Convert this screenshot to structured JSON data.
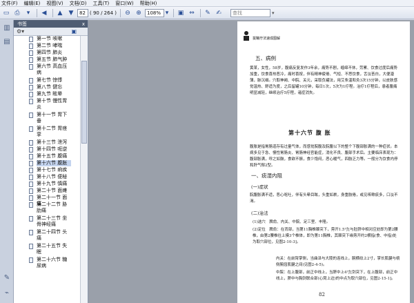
{
  "menu": [
    "文件(F)",
    "编辑(E)",
    "视图(V)",
    "文档(D)",
    "工具(T)",
    "窗口(W)",
    "帮助(H)"
  ],
  "toolbar": {
    "page_current": "82",
    "page_total": "( 90 / 264 )",
    "zoom": "108%",
    "search_placeholder": "查找"
  },
  "panel": {
    "title": "书签",
    "close": "x"
  },
  "bookmarks": [
    {
      "label": "第一节 咳嗽",
      "lines": 1
    },
    {
      "label": "第二节 哮喘",
      "lines": 1
    },
    {
      "label": "第四节 肺炎",
      "lines": 1
    },
    {
      "label": "第五节 肺气肿",
      "lines": 1
    },
    {
      "label": "第六节 高血压病",
      "lines": 2
    },
    {
      "label": "第七节 惊悸",
      "lines": 1
    },
    {
      "label": "第八节 健忘",
      "lines": 1
    },
    {
      "label": "第九节 眩晕",
      "lines": 1
    },
    {
      "label": "第十节 慢性胃炎",
      "lines": 2
    },
    {
      "label": "第十一节 胃下垂",
      "lines": 2
    },
    {
      "label": "第十二节 胃痉挛",
      "lines": 2
    },
    {
      "label": "第十三节 泄泻",
      "lines": 1
    },
    {
      "label": "第十四节 呃逆",
      "lines": 1
    },
    {
      "label": "第十五节 腹痛",
      "lines": 1
    },
    {
      "label": "第十六节 腹胀",
      "lines": 1,
      "selected": true
    },
    {
      "label": "第十七节 痢疾",
      "lines": 1
    },
    {
      "label": "第十八节 便秘",
      "lines": 1
    },
    {
      "label": "第十九节 慎痛",
      "lines": 1
    },
    {
      "label": "第二十节 面瘫",
      "lines": 1
    },
    {
      "label": "第二十一节 面痛",
      "lines": 1
    },
    {
      "label": "第二十二节 胁肋痛",
      "lines": 2
    },
    {
      "label": "第二十三节 坐骨神经痛",
      "lines": 2
    },
    {
      "label": "第二十四节 头痛",
      "lines": 2
    },
    {
      "label": "第二十五节 失眠",
      "lines": 2
    },
    {
      "label": "第二十六节 糖尿病",
      "lines": 2
    }
  ],
  "page": {
    "running_head": "拔罐疗法速成图解",
    "section5": "五、病例",
    "case_text": "黄某，女性，58岁，腹痛反复发作3年余，痛势不剧，缠绵不休，劳累、饮食过度后痛势加重，饮食喜热恶冷，痛时喜按，伴有精神疲倦、气短、不思饮食，舌淡苔白，大便溏薄，脉沉细。穴取神阙、中脘、关元，采取负罐法，用艾条温和灸3次15分钟，以皮肤感觉温热、舒适为度，之后留罐10分钟，每日1次，5次为1疗程。治疗1疗程后，患者腹痛明显减轻，继续治疗5疗程，诸症消失。",
    "chapter": "第十六节 腹 胀",
    "chapter_text": "腹胀是指胃肠道存有过量气体，而感觉脘腹及脘腹以下的整个下腹部胀满的一种症状。本病多见于急、慢性胃肠炎、胃肠神经官能症，消化不良、腹部手术后。主要临床表现为：腹部胀满，呼之如鼓，食欲不振，食少饱闷，恶心暖气，四肢乏力等。一般分为饮食内停和肝气郁2型。",
    "h1": "一、痰湿内阻",
    "h1a": "(一)症状",
    "symptoms": "脘腹胀满不适，恶心呕吐，伴有头晕目眩，头重如裹，身重肢倦，或见咳嗽痰多，口淡不渴。",
    "h1b": "(二)治法",
    "p1": "(1)选穴　脾俞、内关、中脘、足三里、丰隆。",
    "p2": "(2)定位　脾俞：在背部，当第11胸椎棘突下，旁开1.5寸[与肚脐中相对应处即为第2腰椎，由第2腰椎往上摸3个椎体，即为第11胸椎，其棘突下缘旁开约2横指(食、中指)处为取穴部位，见图2-10-3]。",
    "p3": "内关：在前臂掌侧，当曲泽与大陵的连线上，腕横纹上2寸，掌长肌腱与桡侧腕屈肌腱之间(见图2-4-5)。",
    "p4": "中脘：在上腹部，前正中线上，当脐中上4寸[剑突下，在上腹部，前正中线上，脐中与胸剑联合部(心窝上边)的中点为取穴部位，见图2-15-1]。",
    "page_number": "82"
  }
}
